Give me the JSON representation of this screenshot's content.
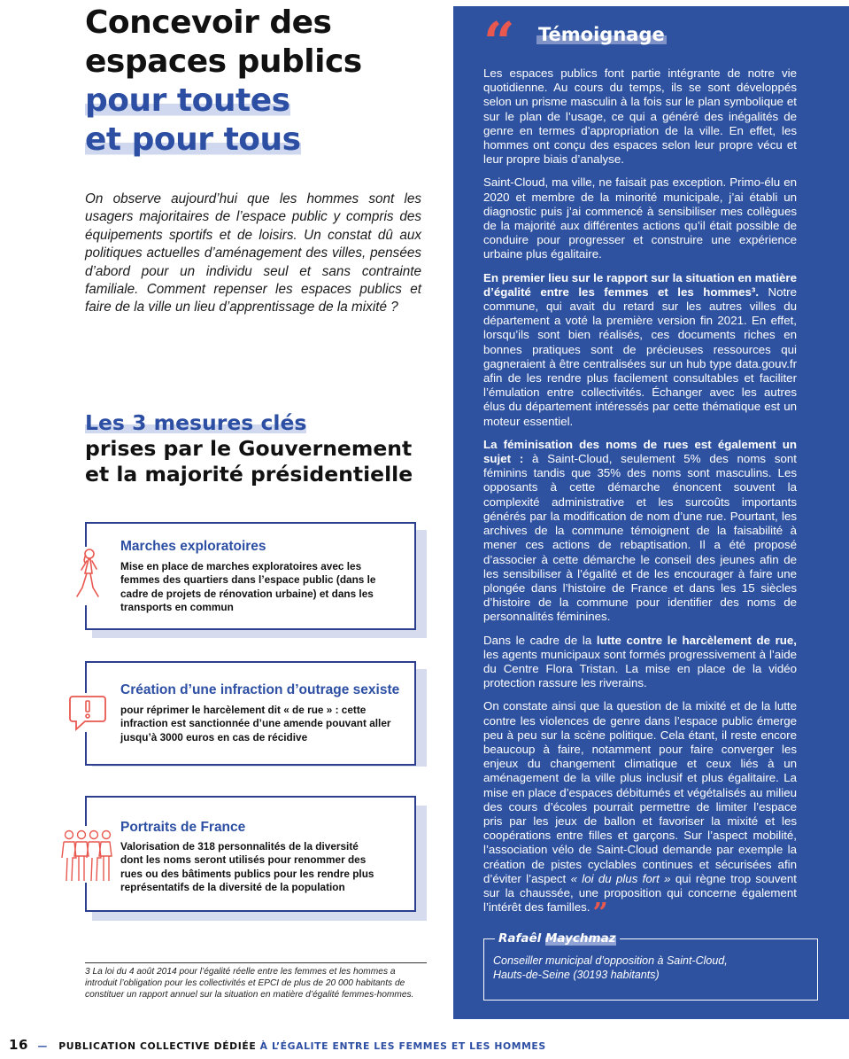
{
  "header": {
    "title_line1": "Concevoir des",
    "title_line2": "espaces publics",
    "title_line3": "pour toutes",
    "title_line4": "et pour tous"
  },
  "intro": "On observe aujourd’hui que les hommes sont les usagers majoritaires de l’espace public y compris des équipements sportifs et de loisirs. Un constat dû aux politiques actuelles d’aménagement des villes, pensées d’abord pour un individu seul et sans contrainte familiale. Comment repenser les espaces publics et faire de la ville un lieu d’apprentissage de la mixité ?",
  "mesures": {
    "title_line1": "Les 3 mesures clés",
    "title_line2": "prises par le Gouvernement",
    "title_line3": "et la majorité présidentielle",
    "cards": [
      {
        "title": "Marches exploratoires",
        "text": "Mise en place de marches exploratoires avec les femmes des quartiers dans l’espace public (dans le cadre de projets de rénovation urbaine) et dans les transports en commun",
        "icon": "walking-woman-icon"
      },
      {
        "title": "Création d’une infraction d’outrage sexiste",
        "text": "pour réprimer le harcèlement dit « de rue » : cette infraction est sanctionnée d’une amende pouvant aller jusqu’à 3000 euros en cas de récidive",
        "icon": "alert-speech-bubble-icon"
      },
      {
        "title": "Portraits de France",
        "text": "Valorisation de 318 personnalités de la diversité dont les noms seront utilisés pour renommer des rues ou des bâtiments publics pour les rendre plus représentatifs de la diversité de la population",
        "icon": "group-of-people-icon"
      }
    ]
  },
  "footnote": "3 La loi du 4 août 2014 pour l’égalité réelle entre les femmes et les hommes a introduit l’obligation pour les collectivités et EPCI de plus de 20 000 habitants de constituer un rapport annuel sur la situation en matière d’égalité femmes-hommes.",
  "testimony": {
    "title": "Témoignage",
    "p1": "Les espaces publics font partie intégrante de notre vie quotidienne. Au cours du temps, ils se sont développés selon un prisme masculin à la fois sur le plan symbolique et sur le plan de l’usage, ce qui a généré des inégalités de genre en termes d’appropriation de la ville. En effet, les hommes ont conçu des espaces selon leur propre vécu et leur propre biais d’analyse.",
    "p2": "Saint-Cloud, ma ville, ne faisait pas exception. Primo-élu en 2020 et membre de la minorité municipale, j’ai établi un diagnostic puis j’ai commencé à sensibiliser mes collègues de la majorité aux différentes actions qu’il était possible de conduire pour progresser et construire une expérience urbaine plus égalitaire.",
    "p3_bold": "En premier lieu sur le rapport sur la situation en matière d’égalité entre les femmes et les hommes³.",
    "p3_rest": " Notre commune, qui avait du retard sur les autres villes du département a voté la première version fin 2021. En effet, lorsqu’ils sont bien réalisés, ces documents riches en bonnes pratiques sont de précieuses ressources qui gagneraient à être centralisées sur un hub type data.gouv.fr afin de les rendre plus facilement consultables et faciliter l’émulation entre collectivités. Échanger avec les autres élus du département intéressés par cette thématique est un moteur essentiel.",
    "p4_bold": "La féminisation des noms de rues est également un sujet :",
    "p4_rest": " à Saint-Cloud, seulement 5% des noms sont féminins tandis que 35% des noms sont masculins. Les opposants à cette démarche énoncent souvent la complexité administrative et les surcoûts importants générés par la modification de nom d’une rue. Pourtant, les archives de la commune témoignent de la faisabilité à mener ces actions de rebaptisation. Il a été proposé d’associer à cette démarche le conseil des jeunes afin de les sensibiliser à l’égalité et de les encourager à faire une plongée dans l’histoire de France et dans les 15 siècles d’histoire de la commune pour identifier des noms de personnalités féminines.",
    "p5_pre": "Dans le cadre de la ",
    "p5_bold": "lutte contre le harcèlement de rue,",
    "p5_rest": " les agents municipaux sont formés progressivement à l’aide du Centre Flora Tristan. La mise en place de la vidéo protection rassure les riverains.",
    "p6_pre": "On constate ainsi que la question de la mixité et de la lutte contre les violences de genre dans l’espace public émerge peu à peu sur la scène politique. Cela étant, il reste encore beaucoup à faire, notamment pour faire converger les enjeux du changement climatique et ceux liés à un aménagement de la ville plus inclusif et plus égalitaire. La mise en place d’espaces débitumés et végétalisés au milieu des cours d’écoles pourrait permettre de limiter l’espace pris par les jeux de ballon et favoriser la mixité et les coopérations entre filles et garçons. Sur l’aspect mobilité, l’association vélo de Saint-Cloud demande par exemple la création de pistes cyclables continues et sécurisées afin d’éviter l’aspect ",
    "p6_italic": "« loi du plus fort »",
    "p6_rest": " qui règne trop souvent sur la chaussée, une proposition qui concerne également l’intérêt des familles.",
    "signature_first": "Rafaêl",
    "signature_last": "Maychmaz",
    "role_line1": "Conseiller municipal d’opposition à Saint-Cloud,",
    "role_line2": "Hauts-de-Seine (30193 habitants)"
  },
  "footer": {
    "page_number": "16",
    "dash": "—",
    "publication": "PUBLICATION COLLECTIVE DÉDIÉE",
    "publication_blue": "À L’ÉGALITE ENTRE LES FEMMES ET LES HOMMES"
  },
  "colors": {
    "brand_blue": "#2c4ea3",
    "panel_blue": "#2f52a0",
    "accent_red": "#e8584f"
  }
}
